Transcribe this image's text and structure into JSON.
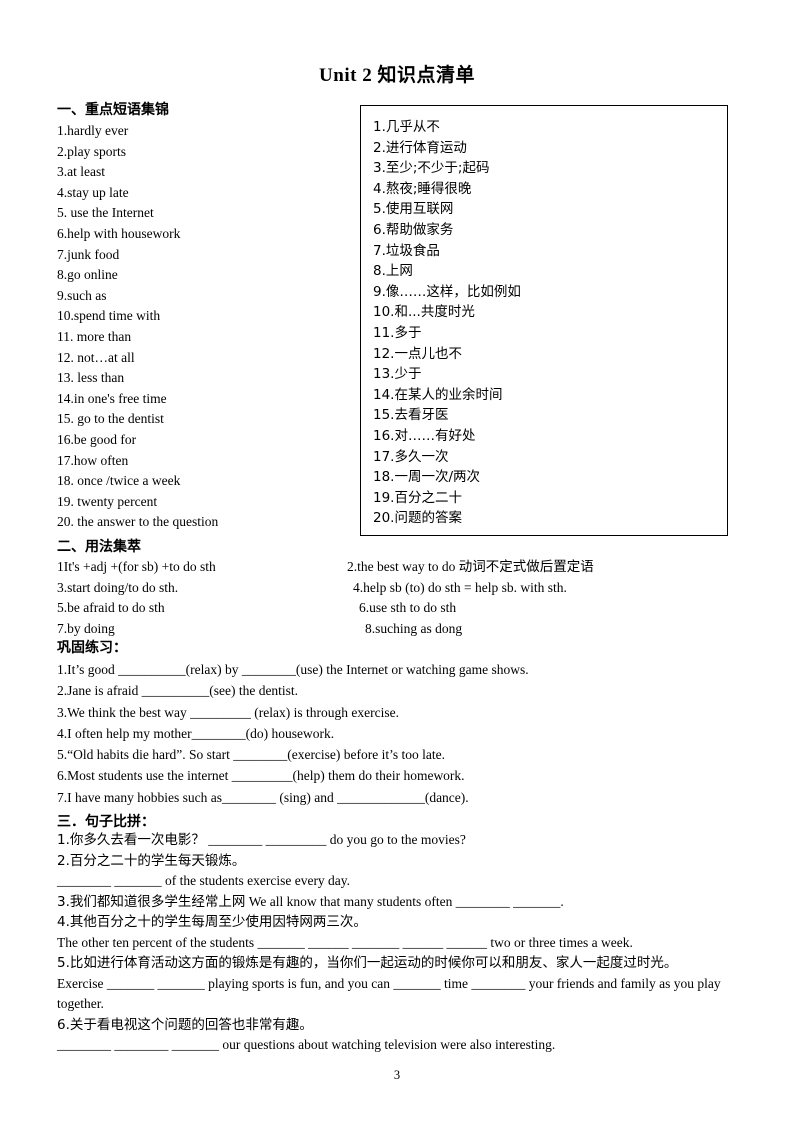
{
  "document": {
    "title": "Unit 2  知识点清单",
    "page_number": "3"
  },
  "section1": {
    "heading": "一、重点短语集锦",
    "phrases": [
      "1.hardly ever",
      "2.play sports",
      "3.at least",
      "4.stay up late",
      "5. use the Internet",
      "6.help with housework",
      "7.junk food",
      "8.go online",
      "9.such as",
      "10.spend time with",
      "11. more than",
      "12. not…at all",
      "13. less than",
      "14.in one's free time",
      "15. go to the dentist",
      "16.be good for",
      "17.how often",
      "18. once /twice a week",
      "19. twenty percent",
      "20. the answer to the question"
    ],
    "translations": [
      "1.几乎从不",
      "2.进行体育运动",
      "3.至少;不少于;起码",
      "4.熬夜;睡得很晚",
      "5.使用互联网",
      "6.帮助做家务",
      "7.垃圾食品",
      "8.上网",
      "9.像……这样，比如例如",
      "10.和...共度时光",
      "11.多于",
      "12.一点儿也不",
      "13.少于",
      "14.在某人的业余时间",
      "15.去看牙医",
      "16.对……有好处",
      "17.多久一次",
      "18.一周一次/两次",
      "19.百分之二十",
      "20.问题的答案"
    ]
  },
  "section2": {
    "heading": "二、用法集萃",
    "rows": [
      {
        "left": "1It's +adj +(for sb) +to do sth",
        "right_pre": "2.the best way to do ",
        "right_cjk": "动词不定式做后置定语",
        "right_post": ""
      },
      {
        "left": "3.start doing/to do sth.",
        "right_pre": "4.help sb (to) do sth = help sb. with sth.",
        "right_cjk": "",
        "right_post": ""
      },
      {
        "left": "5.be afraid to do sth",
        "right_pre": "6.use sth to do sth",
        "right_cjk": "",
        "right_post": ""
      },
      {
        "left": "7.by doing",
        "right_pre": "8.suching as dong",
        "right_cjk": "",
        "right_post": ""
      }
    ]
  },
  "section3": {
    "heading": "巩固练习：",
    "items": [
      "1.It’s good __________(relax) by ________(use) the Internet or watching game shows.",
      "2.Jane is afraid __________(see) the dentist.",
      "3.We think the best way _________ (relax) is through exercise.",
      "4.I often help my mother________(do) housework.",
      "5.“Old habits die hard”. So start ________(exercise) before it’s too late.",
      "6.Most students use the internet _________(help) them do their homework.",
      "7.I have many hobbies such as________ (sing) and _____________(dance)."
    ]
  },
  "section4": {
    "heading": "三．句子比拼：",
    "items": [
      {
        "type": "mixed",
        "cn": "1.你多久去看一次电影？",
        "en": " ________ _________ do you go to the movies?"
      },
      {
        "type": "cn",
        "cn": "2.百分之二十的学生每天锻炼。"
      },
      {
        "type": "en",
        "en": "________ _______  of the students exercise every day."
      },
      {
        "type": "mixed",
        "cn": "3.我们都知道很多学生经常上网",
        "en": "  We all know that many students often ________ _______."
      },
      {
        "type": "cn",
        "cn": "4.其他百分之十的学生每周至少使用因特网两三次。"
      },
      {
        "type": "en",
        "en": "The other ten percent of the students _______ ______ _______ ______ ______ two or three times a week."
      },
      {
        "type": "cn",
        "cn": "5.比如进行体育活动这方面的锻炼是有趣的，当你们一起运动的时候你可以和朋友、家人一起度过时光。"
      },
      {
        "type": "en",
        "en": "Exercise _______ _______ playing sports is fun, and you can _______ time ________ your friends and family as you play together."
      },
      {
        "type": "cn",
        "cn": "6.关于看电视这个问题的回答也非常有趣。"
      },
      {
        "type": "en",
        "en": "________ ________ _______ our questions about watching television were also interesting."
      }
    ]
  }
}
